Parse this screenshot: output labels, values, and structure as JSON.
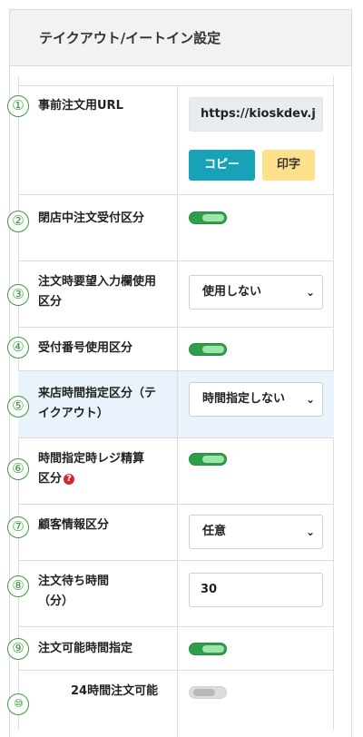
{
  "card": {
    "title": "テイクアウト/イートイン設定"
  },
  "rows": [
    {
      "num": "①",
      "label": "事前注文用URL",
      "url": "https://kioskdev.j",
      "copy": "コピー",
      "print": "印字"
    },
    {
      "num": "②",
      "label": "閉店中注文受付区分",
      "toggle": "on"
    },
    {
      "num": "③",
      "label": "注文時要望入力欄使用区分",
      "select": "使用しない"
    },
    {
      "num": "④",
      "label": "受付番号使用区分",
      "toggle": "on"
    },
    {
      "num": "⑤",
      "label": "来店時間指定区分（テイクアウト）",
      "select": "時間指定しない"
    },
    {
      "num": "⑥",
      "label": "時間指定時レジ精算区分",
      "toggle": "on"
    },
    {
      "num": "⑦",
      "label": "顧客情報区分",
      "select": "任意"
    },
    {
      "num": "⑧",
      "label": "注文待ち時間（分）",
      "input": "30"
    },
    {
      "num": "⑨",
      "label": "注文可能時間指定",
      "toggle": "on"
    },
    {
      "num": "⑩",
      "label": "24時間注文可能",
      "toggle": "off"
    }
  ],
  "icons": {
    "help": "question-circle-icon",
    "caret": "chevron-down-icon",
    "accent": "#17a2b8",
    "toggle_on": "#2e9e4b"
  }
}
